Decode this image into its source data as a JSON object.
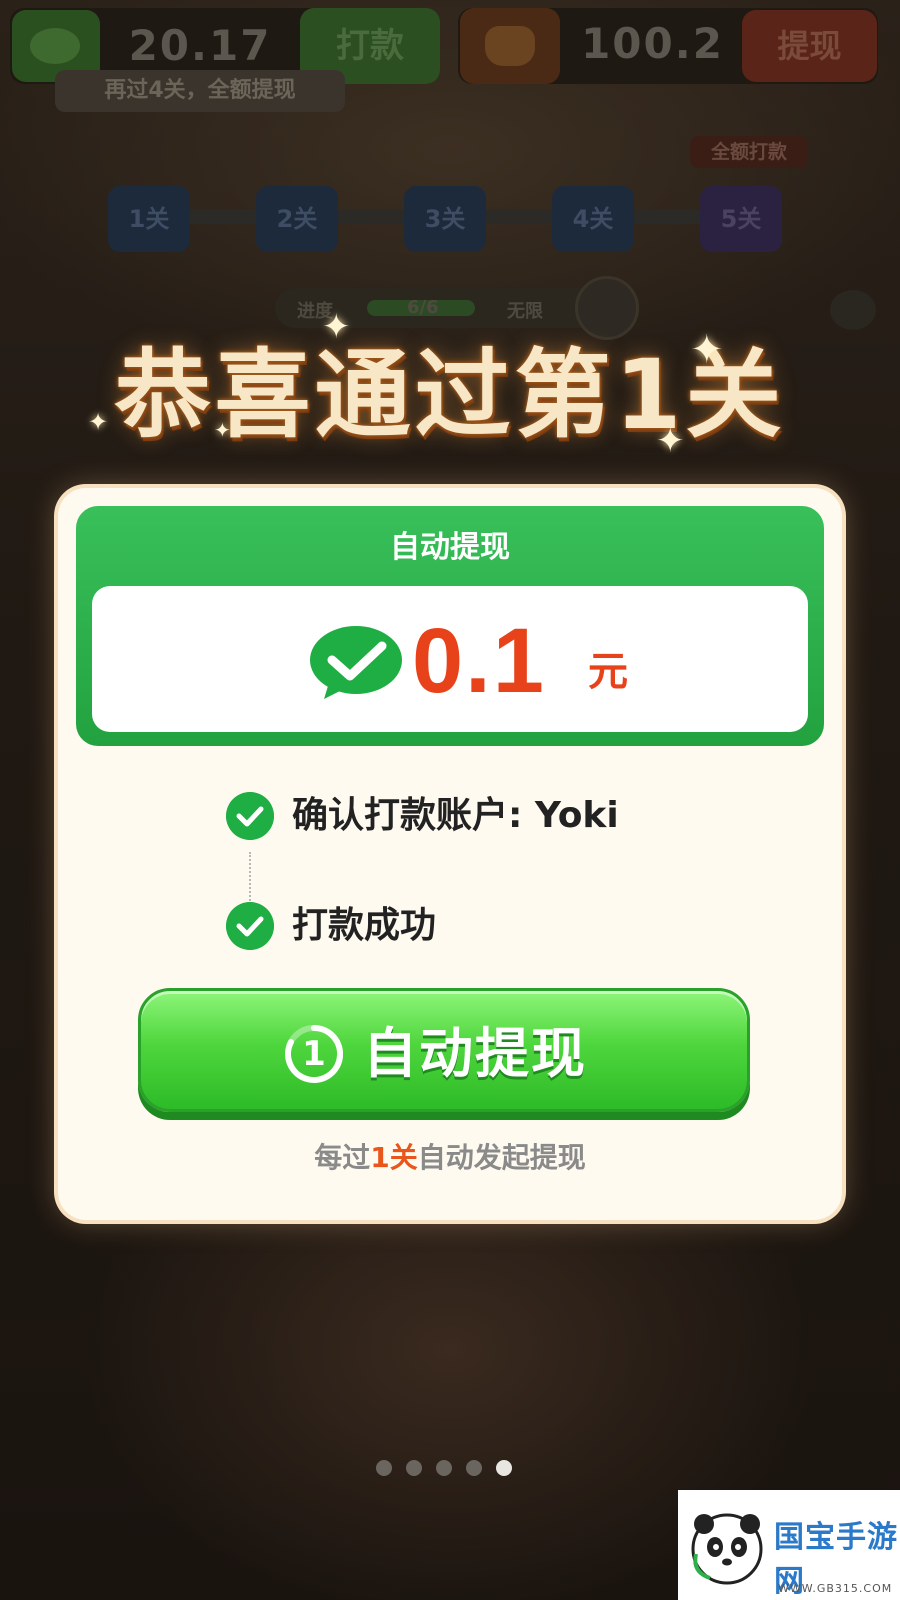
{
  "header": {
    "left_balance": "20.17",
    "pay_button_label": "打款",
    "hint_text": "再过4关，全额提现",
    "right_balance": "100.2",
    "withdraw_button_label": "提现"
  },
  "level_track": {
    "full_payout_tag": "全额打款",
    "levels": [
      "1关",
      "2关",
      "3关",
      "4关",
      "5关"
    ]
  },
  "progress": {
    "label": "进度",
    "value": "6/6",
    "mode": "无限"
  },
  "congrats": {
    "title": "恭喜通过第1关"
  },
  "modal": {
    "card_title": "自动提现",
    "amount": "0.1",
    "unit": "元",
    "steps": [
      {
        "label": "确认打款账户: Yoki",
        "done": true
      },
      {
        "label": "打款成功",
        "done": true
      }
    ],
    "button": {
      "countdown": "1",
      "label": "自动提现"
    },
    "footer": {
      "prefix": "每过",
      "highlight": "1关",
      "suffix": "自动发起提现"
    }
  },
  "pagination": {
    "total": 5,
    "active_index": 4
  },
  "watermark": {
    "name": "国宝手游网",
    "url": "· WWW.GB315.COM ·"
  },
  "colors": {
    "accent_green": "#22a23f",
    "amount_red": "#e8421b",
    "highlight_orange": "#e8561b"
  }
}
